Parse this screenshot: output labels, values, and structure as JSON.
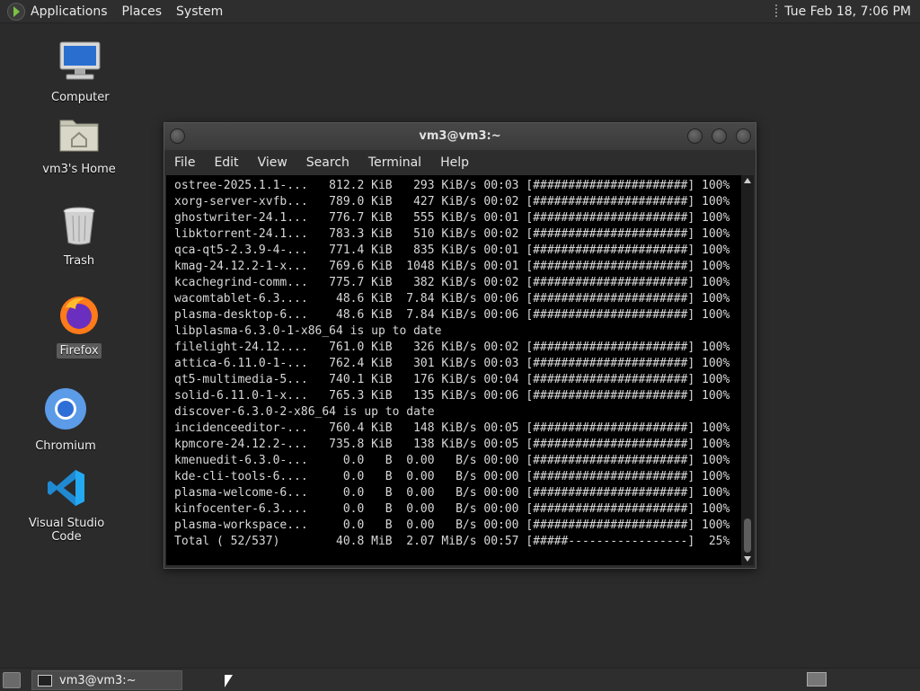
{
  "top_panel": {
    "menus": [
      "Applications",
      "Places",
      "System"
    ],
    "clock": "Tue Feb 18,  7:06 PM"
  },
  "desktop_icons": [
    {
      "label": "Computer",
      "icon": "computer-icon"
    },
    {
      "label": "vm3's Home",
      "icon": "home-folder-icon"
    },
    {
      "label": "Trash",
      "icon": "trash-icon"
    },
    {
      "label": "Firefox",
      "icon": "firefox-icon"
    },
    {
      "label": "Chromium",
      "icon": "chromium-icon"
    },
    {
      "label": "Visual Studio Code",
      "icon": "vscode-icon"
    }
  ],
  "terminal": {
    "title": "vm3@vm3:~",
    "menu": [
      "File",
      "Edit",
      "View",
      "Search",
      "Terminal",
      "Help"
    ],
    "lines": [
      "ostree-2025.1.1-...   812.2 KiB   293 KiB/s 00:03 [######################] 100%",
      "xorg-server-xvfb...   789.0 KiB   427 KiB/s 00:02 [######################] 100%",
      "ghostwriter-24.1...   776.7 KiB   555 KiB/s 00:01 [######################] 100%",
      "libktorrent-24.1...   783.3 KiB   510 KiB/s 00:02 [######################] 100%",
      "qca-qt5-2.3.9-4-...   771.4 KiB   835 KiB/s 00:01 [######################] 100%",
      "kmag-24.12.2-1-x...   769.6 KiB  1048 KiB/s 00:01 [######################] 100%",
      "kcachegrind-comm...   775.7 KiB   382 KiB/s 00:02 [######################] 100%",
      "wacomtablet-6.3....    48.6 KiB  7.84 KiB/s 00:06 [######################] 100%",
      "plasma-desktop-6...    48.6 KiB  7.84 KiB/s 00:06 [######################] 100%",
      "libplasma-6.3.0-1-x86_64 is up to date",
      "filelight-24.12....   761.0 KiB   326 KiB/s 00:02 [######################] 100%",
      "attica-6.11.0-1-...   762.4 KiB   301 KiB/s 00:03 [######################] 100%",
      "qt5-multimedia-5...   740.1 KiB   176 KiB/s 00:04 [######################] 100%",
      "solid-6.11.0-1-x...   765.3 KiB   135 KiB/s 00:06 [######################] 100%",
      "discover-6.3.0-2-x86_64 is up to date",
      "incidenceeditor-...   760.4 KiB   148 KiB/s 00:05 [######################] 100%",
      "kpmcore-24.12.2-...   735.8 KiB   138 KiB/s 00:05 [######################] 100%",
      "kmenuedit-6.3.0-...     0.0   B  0.00   B/s 00:00 [######################] 100%",
      "kde-cli-tools-6....     0.0   B  0.00   B/s 00:00 [######################] 100%",
      "plasma-welcome-6...     0.0   B  0.00   B/s 00:00 [######################] 100%",
      "kinfocenter-6.3....     0.0   B  0.00   B/s 00:00 [######################] 100%",
      "plasma-workspace...     0.0   B  0.00   B/s 00:00 [######################] 100%",
      "Total ( 52/537)        40.8 MiB  2.07 MiB/s 00:57 [#####-----------------]  25%"
    ]
  },
  "taskbar": {
    "items": [
      {
        "label": "vm3@vm3:~",
        "icon": "terminal-icon"
      }
    ]
  }
}
